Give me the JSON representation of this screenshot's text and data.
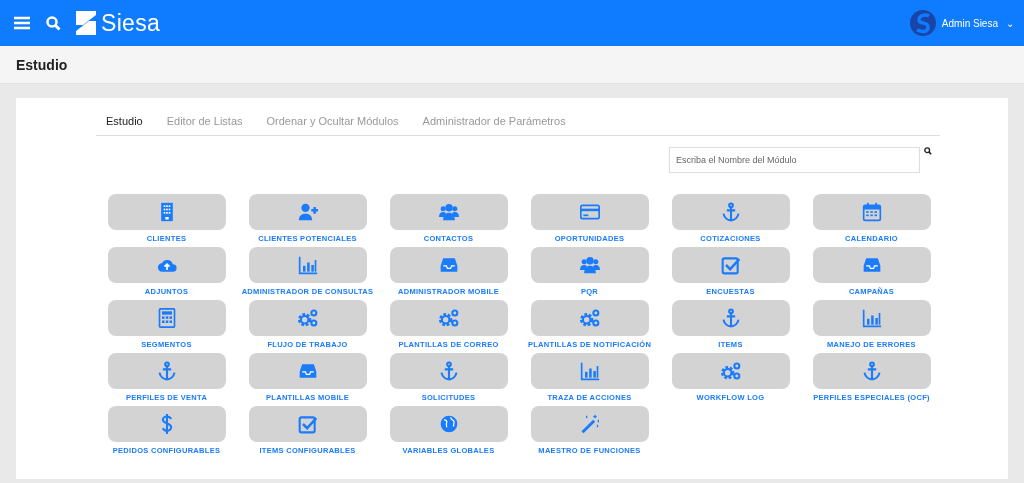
{
  "header": {
    "brand": "Siesa",
    "user": "Admin Siesa",
    "user_caret": "⌄"
  },
  "page_title": "Estudio",
  "tabs": [
    {
      "label": "Estudio",
      "selected": true
    },
    {
      "label": "Editor de Listas",
      "selected": false
    },
    {
      "label": "Ordenar y Ocultar Módulos",
      "selected": false
    },
    {
      "label": "Administrador de Parámetros",
      "selected": false
    }
  ],
  "search": {
    "placeholder": "Escriba el Nombre del Módulo"
  },
  "modules": [
    {
      "label": "CLIENTES",
      "kind": "building"
    },
    {
      "label": "CLIENTES POTENCIALES",
      "kind": "user-plus"
    },
    {
      "label": "CONTACTOS",
      "kind": "users"
    },
    {
      "label": "OPORTUNIDADES",
      "kind": "card"
    },
    {
      "label": "COTIZACIONES",
      "kind": "anchor"
    },
    {
      "label": "CALENDARIO",
      "kind": "calendar"
    },
    {
      "label": "ADJUNTOS",
      "kind": "cloud"
    },
    {
      "label": "ADMINISTRADOR DE CONSULTAS",
      "kind": "chart"
    },
    {
      "label": "ADMINISTRADOR MOBILE",
      "kind": "inbox"
    },
    {
      "label": "PQR",
      "kind": "users"
    },
    {
      "label": "ENCUESTAS",
      "kind": "check"
    },
    {
      "label": "CAMPAÑAS",
      "kind": "inbox"
    },
    {
      "label": "SEGMENTOS",
      "kind": "calculator"
    },
    {
      "label": "FLUJO DE TRABAJO",
      "kind": "cogs"
    },
    {
      "label": "PLANTILLAS DE CORREO",
      "kind": "cogs"
    },
    {
      "label": "PLANTILLAS DE NOTIFICACIÓN",
      "kind": "cogs"
    },
    {
      "label": "ITEMS",
      "kind": "anchor"
    },
    {
      "label": "MANEJO DE ERRORES",
      "kind": "chart"
    },
    {
      "label": "PERFILES DE VENTA",
      "kind": "anchor"
    },
    {
      "label": "PLANTILLAS MOBILE",
      "kind": "inbox"
    },
    {
      "label": "SOLICITUDES",
      "kind": "anchor"
    },
    {
      "label": "TRAZA DE ACCIONES",
      "kind": "chart"
    },
    {
      "label": "WORKFLOW LOG",
      "kind": "cogs"
    },
    {
      "label": "PERFILES ESPECIALES (OCF)",
      "kind": "anchor"
    },
    {
      "label": "PEDIDOS CONFIGURABLES",
      "kind": "dollar"
    },
    {
      "label": "ITEMS CONFIGURABLES",
      "kind": "check"
    },
    {
      "label": "VARIABLES GLOBALES",
      "kind": "globe"
    },
    {
      "label": "MAESTRO DE FUNCIONES",
      "kind": "wand"
    }
  ]
}
